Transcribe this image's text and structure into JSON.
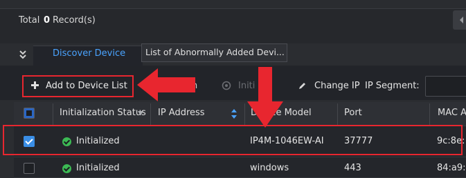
{
  "summary": {
    "total_label": "Total",
    "total_count": "0",
    "total_suffix": "Record(s)"
  },
  "tabs": [
    {
      "label": "Discover Device",
      "active": true
    },
    {
      "label": "List of Abnormally Added Devi...",
      "active": false
    }
  ],
  "toolbar": {
    "add_label": "Add to Device List",
    "search_fragment": "h",
    "initialize_fragment": "Initi",
    "change_ip_label": "Change IP",
    "ip_segment_label": "IP Segment:",
    "ip_segment_value": ""
  },
  "table": {
    "columns": [
      "Initialization Status",
      "IP Address",
      "Device Model",
      "Port",
      "MAC A"
    ],
    "rows": [
      {
        "checked": true,
        "status": "Initialized",
        "ip": "",
        "model": "IP4M-1046EW-AI",
        "port": "37777",
        "mac": "9c:8e:"
      },
      {
        "checked": false,
        "status": "Initialized",
        "ip": "",
        "model": "windows",
        "port": "443",
        "mac": "84:a9:"
      }
    ]
  },
  "colors": {
    "accent": "#4aa3ff",
    "success": "#3cba54",
    "annotation": "#e8262f",
    "checkbox": "#3a8ee6"
  },
  "icons": [
    "collapse-chevrons-icon",
    "plus-icon",
    "initialize-icon",
    "pencil-icon",
    "filter-icon",
    "sort-icon",
    "check-circle-icon"
  ]
}
